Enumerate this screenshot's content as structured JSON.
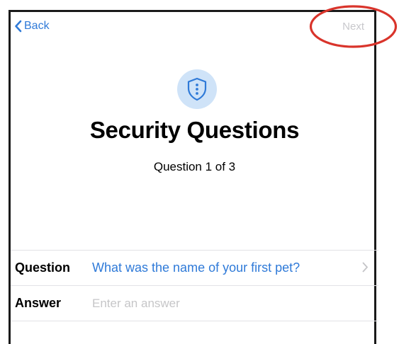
{
  "nav": {
    "back_label": "Back",
    "next_label": "Next"
  },
  "header": {
    "icon": "shield-icon",
    "title": "Security Questions",
    "subtitle": "Question 1 of 3"
  },
  "form": {
    "question_label": "Question",
    "question_value": "What was the name of your first pet?",
    "answer_label": "Answer",
    "answer_placeholder": "Enter an answer",
    "answer_value": ""
  },
  "annotation": {
    "color": "#d9342b"
  },
  "colors": {
    "accent": "#2f7ad8",
    "disabled": "#c8c8cc",
    "icon_bg": "#cfe3f8"
  }
}
